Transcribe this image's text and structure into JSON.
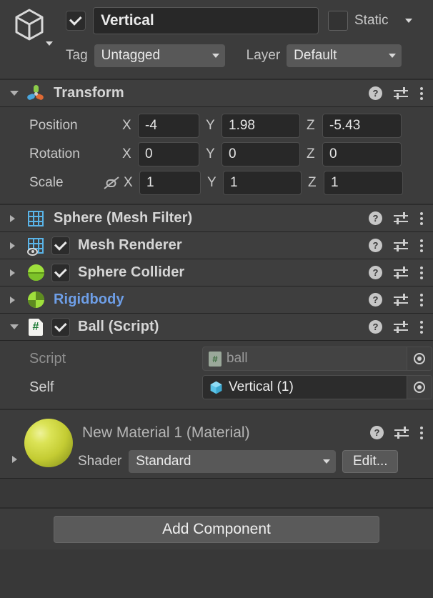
{
  "header": {
    "object_icon": "cube-icon",
    "enabled": true,
    "name": "Vertical",
    "static_checked": false,
    "static_label": "Static",
    "tag_label": "Tag",
    "tag_value": "Untagged",
    "layer_label": "Layer",
    "layer_value": "Default"
  },
  "transform": {
    "title": "Transform",
    "icon": "transform-gizmo-icon",
    "expanded": true,
    "rows": [
      {
        "label": "Position",
        "x": "-4",
        "y": "1.98",
        "z": "-5.43"
      },
      {
        "label": "Rotation",
        "x": "0",
        "y": "0",
        "z": "0"
      },
      {
        "label": "Scale",
        "x": "1",
        "y": "1",
        "z": "1"
      }
    ],
    "axis_x": "X",
    "axis_y": "Y",
    "axis_z": "Z",
    "scale_link_icon": "broken-link-icon"
  },
  "components": [
    {
      "title": "Sphere (Mesh Filter)",
      "icon": "mesh-filter-icon",
      "has_checkbox": false,
      "checked": false,
      "expanded": false,
      "highlighted": false
    },
    {
      "title": "Mesh Renderer",
      "icon": "mesh-renderer-icon",
      "has_checkbox": true,
      "checked": true,
      "expanded": false,
      "highlighted": false
    },
    {
      "title": "Sphere Collider",
      "icon": "sphere-collider-icon",
      "has_checkbox": true,
      "checked": true,
      "expanded": false,
      "highlighted": false
    },
    {
      "title": "Rigidbody",
      "icon": "rigidbody-icon",
      "has_checkbox": false,
      "checked": false,
      "expanded": false,
      "highlighted": true
    }
  ],
  "script_component": {
    "title": "Ball (Script)",
    "icon": "csharp-script-icon",
    "checked": true,
    "expanded": true,
    "fields": [
      {
        "label": "Script",
        "value": "ball",
        "icon": "csharp-script-icon",
        "disabled": true
      },
      {
        "label": "Self",
        "value": "Vertical (1)",
        "icon": "gameobject-cube-icon",
        "disabled": false
      }
    ]
  },
  "material": {
    "title": "New Material 1 (Material)",
    "preview_color": "#c8cf3c",
    "shader_label": "Shader",
    "shader_value": "Standard",
    "edit_label": "Edit..."
  },
  "footer": {
    "add_component_label": "Add Component"
  },
  "icons": {
    "help": "?",
    "hash": "#"
  }
}
